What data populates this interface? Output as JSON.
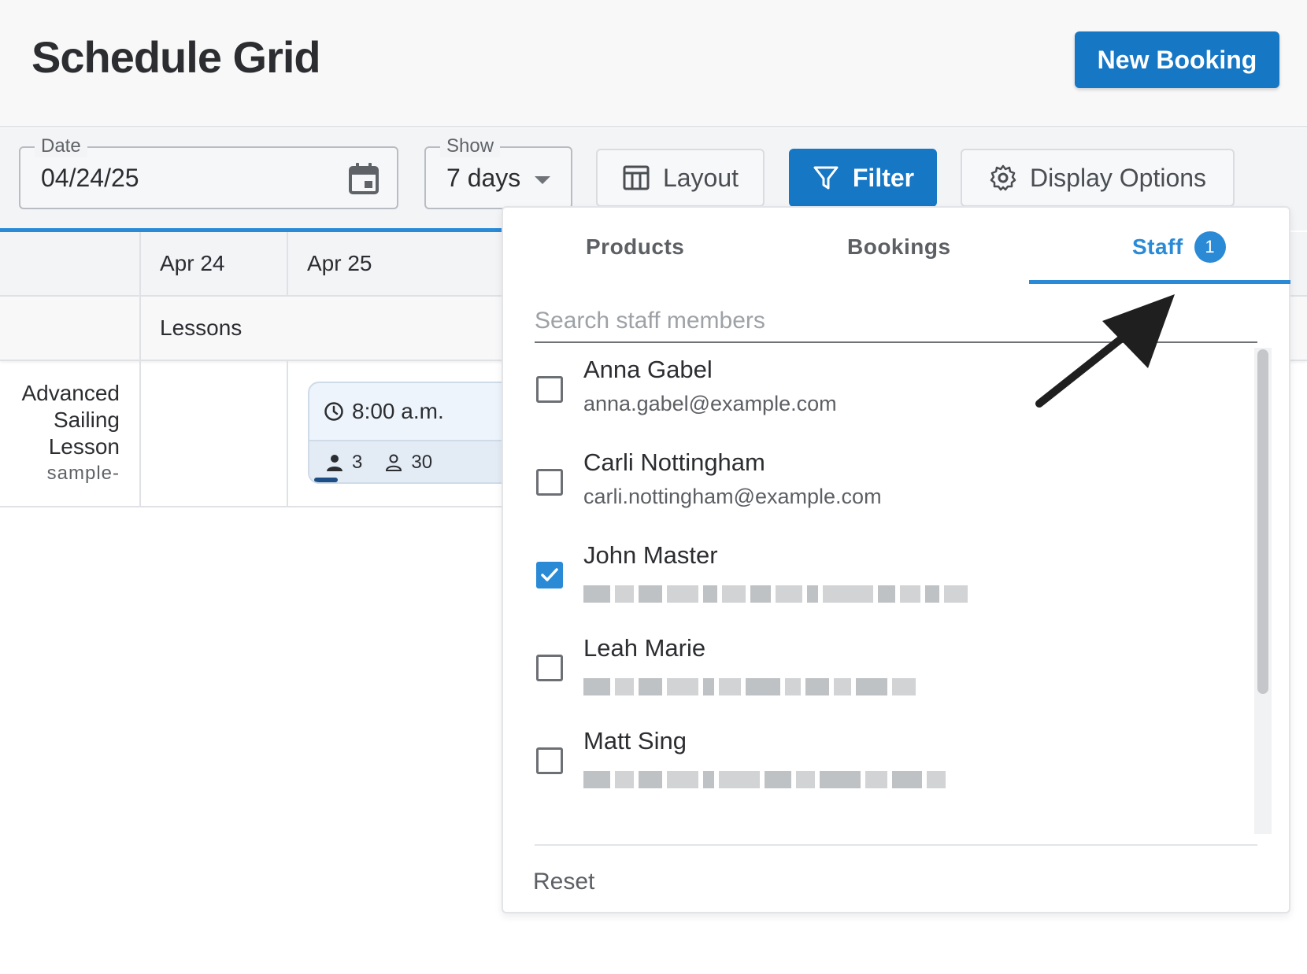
{
  "header": {
    "title": "Schedule Grid",
    "new_booking_label": "New Booking"
  },
  "toolbar": {
    "date": {
      "legend": "Date",
      "value": "04/24/25"
    },
    "show": {
      "legend": "Show",
      "value": "7 days"
    },
    "layout_label": "Layout",
    "filter_label": "Filter",
    "display_options_label": "Display Options"
  },
  "grid": {
    "columns": [
      "Apr 24",
      "Apr 25"
    ],
    "category": "Lessons",
    "product": {
      "name_lines": [
        "Advanced",
        "Sailing",
        "Lesson"
      ],
      "sku": "sample-"
    },
    "event": {
      "time": "8:00 a.m.",
      "booked": "3",
      "capacity": "30"
    }
  },
  "filter_panel": {
    "tabs": [
      "Products",
      "Bookings",
      "Staff"
    ],
    "active_tab": "Staff",
    "staff_badge": "1",
    "search_placeholder": "Search staff members",
    "staff": [
      {
        "name": "Anna Gabel",
        "email": "anna.gabel@example.com",
        "checked": false
      },
      {
        "name": "Carli Nottingham",
        "email": "carli.nottingham@example.com",
        "checked": false
      },
      {
        "name": "John Master",
        "email": null,
        "checked": true
      },
      {
        "name": "Leah Marie",
        "email": null,
        "checked": false
      },
      {
        "name": "Matt Sing",
        "email": null,
        "checked": false
      }
    ],
    "reset_label": "Reset"
  },
  "colors": {
    "primary": "#1677c5",
    "accent": "#2a8ad6",
    "text": "#2c2d31"
  }
}
